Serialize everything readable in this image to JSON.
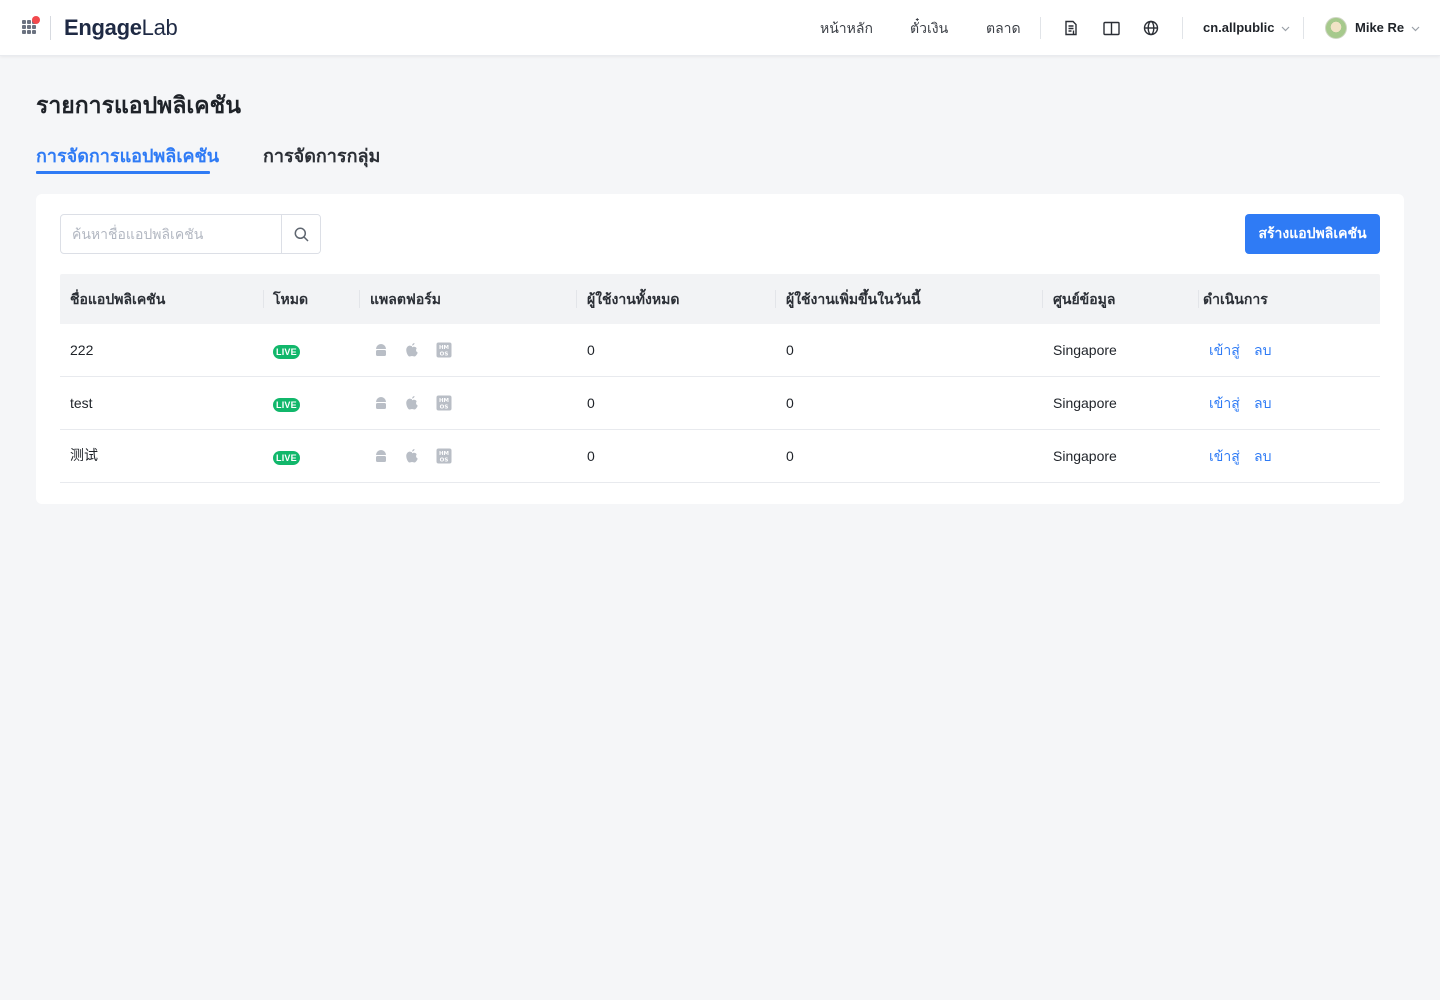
{
  "header": {
    "logo_main": "Engage",
    "logo_sub": "Lab",
    "nav": [
      {
        "label": "หน้าหลัก"
      },
      {
        "label": "ตั๋วเงิน"
      },
      {
        "label": "ตลาด"
      }
    ],
    "icons": [
      "document-icon",
      "book-icon",
      "globe-icon"
    ],
    "workspace": "cn.allpublic",
    "username": "Mike Re",
    "accent_dot_color": "#f2494d"
  },
  "page": {
    "title": "รายการแอปพลิเคชัน",
    "tabs": [
      {
        "label": "การจัดการแอปพลิเคชัน",
        "active": true
      },
      {
        "label": "การจัดการกลุ่ม",
        "active": false
      }
    ]
  },
  "toolbar": {
    "search_placeholder": "ค้นหาชื่อแอปพลิเคชัน",
    "search_value": "",
    "create_label": "สร้างแอปพลิเคชัน"
  },
  "table": {
    "columns": [
      "ชื่อแอปพลิเคชัน",
      "โหมด",
      "แพลตฟอร์ม",
      "ผู้ใช้งานทั้งหมด",
      "ผู้ใช้งานเพิ่มขึ้นในวันนี้",
      "ศูนย์ข้อมูล",
      "ดำเนินการ"
    ],
    "rows": [
      {
        "name": "222",
        "mode": "LIVE",
        "platforms": [
          "android-icon",
          "apple-icon",
          "harmonyos-icon"
        ],
        "total_users": "0",
        "new_users_today": "0",
        "datacenter": "Singapore",
        "actions": [
          "เข้าสู่",
          "ลบ"
        ]
      },
      {
        "name": "test",
        "mode": "LIVE",
        "platforms": [
          "android-icon",
          "apple-icon",
          "harmonyos-icon"
        ],
        "total_users": "0",
        "new_users_today": "0",
        "datacenter": "Singapore",
        "actions": [
          "เข้าสู่",
          "ลบ"
        ]
      },
      {
        "name": "测试",
        "mode": "LIVE",
        "platforms": [
          "android-icon",
          "apple-icon",
          "harmonyos-icon"
        ],
        "total_users": "0",
        "new_users_today": "0",
        "datacenter": "Singapore",
        "actions": [
          "เข้าสู่",
          "ลบ"
        ]
      }
    ]
  },
  "colors": {
    "primary": "#2f7bf5",
    "live_badge": "#11b76b",
    "background": "#f5f6f8"
  }
}
